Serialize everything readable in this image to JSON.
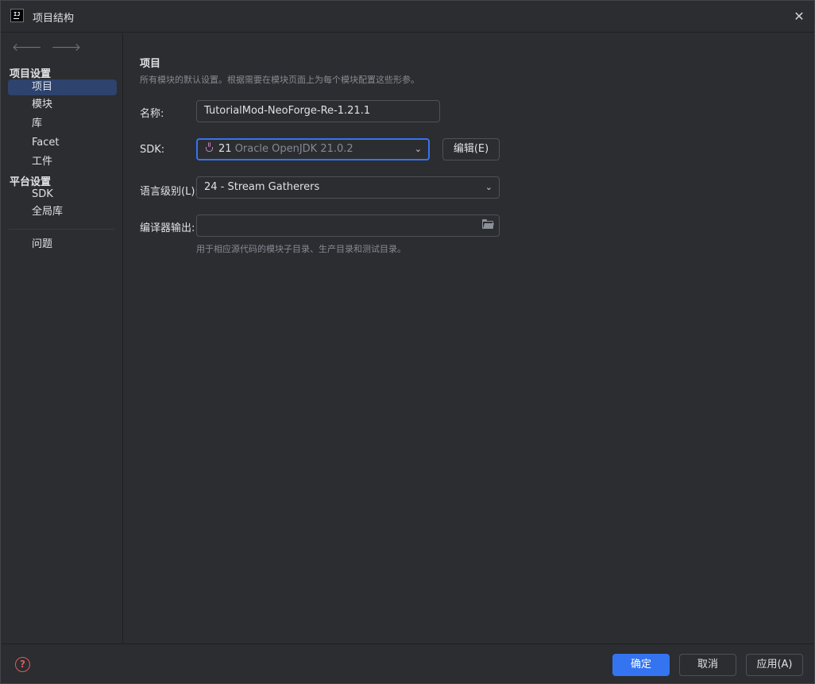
{
  "window": {
    "title": "项目结构"
  },
  "sidebar": {
    "section_project": "项目设置",
    "project_items": [
      {
        "label": "项目",
        "selected": true
      },
      {
        "label": "模块"
      },
      {
        "label": "库"
      },
      {
        "label": "Facet"
      },
      {
        "label": "工件"
      }
    ],
    "section_platform": "平台设置",
    "platform_items": [
      {
        "label": "SDK"
      },
      {
        "label": "全局库"
      }
    ],
    "problems_label": "问题"
  },
  "main": {
    "title": "项目",
    "description": "所有模块的默认设置。根据需要在模块页面上为每个模块配置这些形参。",
    "name_label": "名称:",
    "name_value": "TutorialMod-NeoForge-Re-1.21.1",
    "sdk_label": "SDK:",
    "sdk_version": "21",
    "sdk_name": "Oracle OpenJDK 21.0.2",
    "sdk_edit_button": "编辑(E)",
    "language_level_label": "语言级别(L):",
    "language_level_value": "24 - Stream Gatherers",
    "compiler_output_label": "编译器输出:",
    "compiler_output_value": "",
    "compiler_output_hint": "用于相应源代码的模块子目录、生产目录和测试目录。"
  },
  "footer": {
    "ok_button": "确定",
    "cancel_button": "取消",
    "apply_button": "应用(A)"
  },
  "colors": {
    "accent": "#3574f0",
    "selection": "#2e436e",
    "background": "#2b2d30",
    "help": "#db5c5c"
  }
}
